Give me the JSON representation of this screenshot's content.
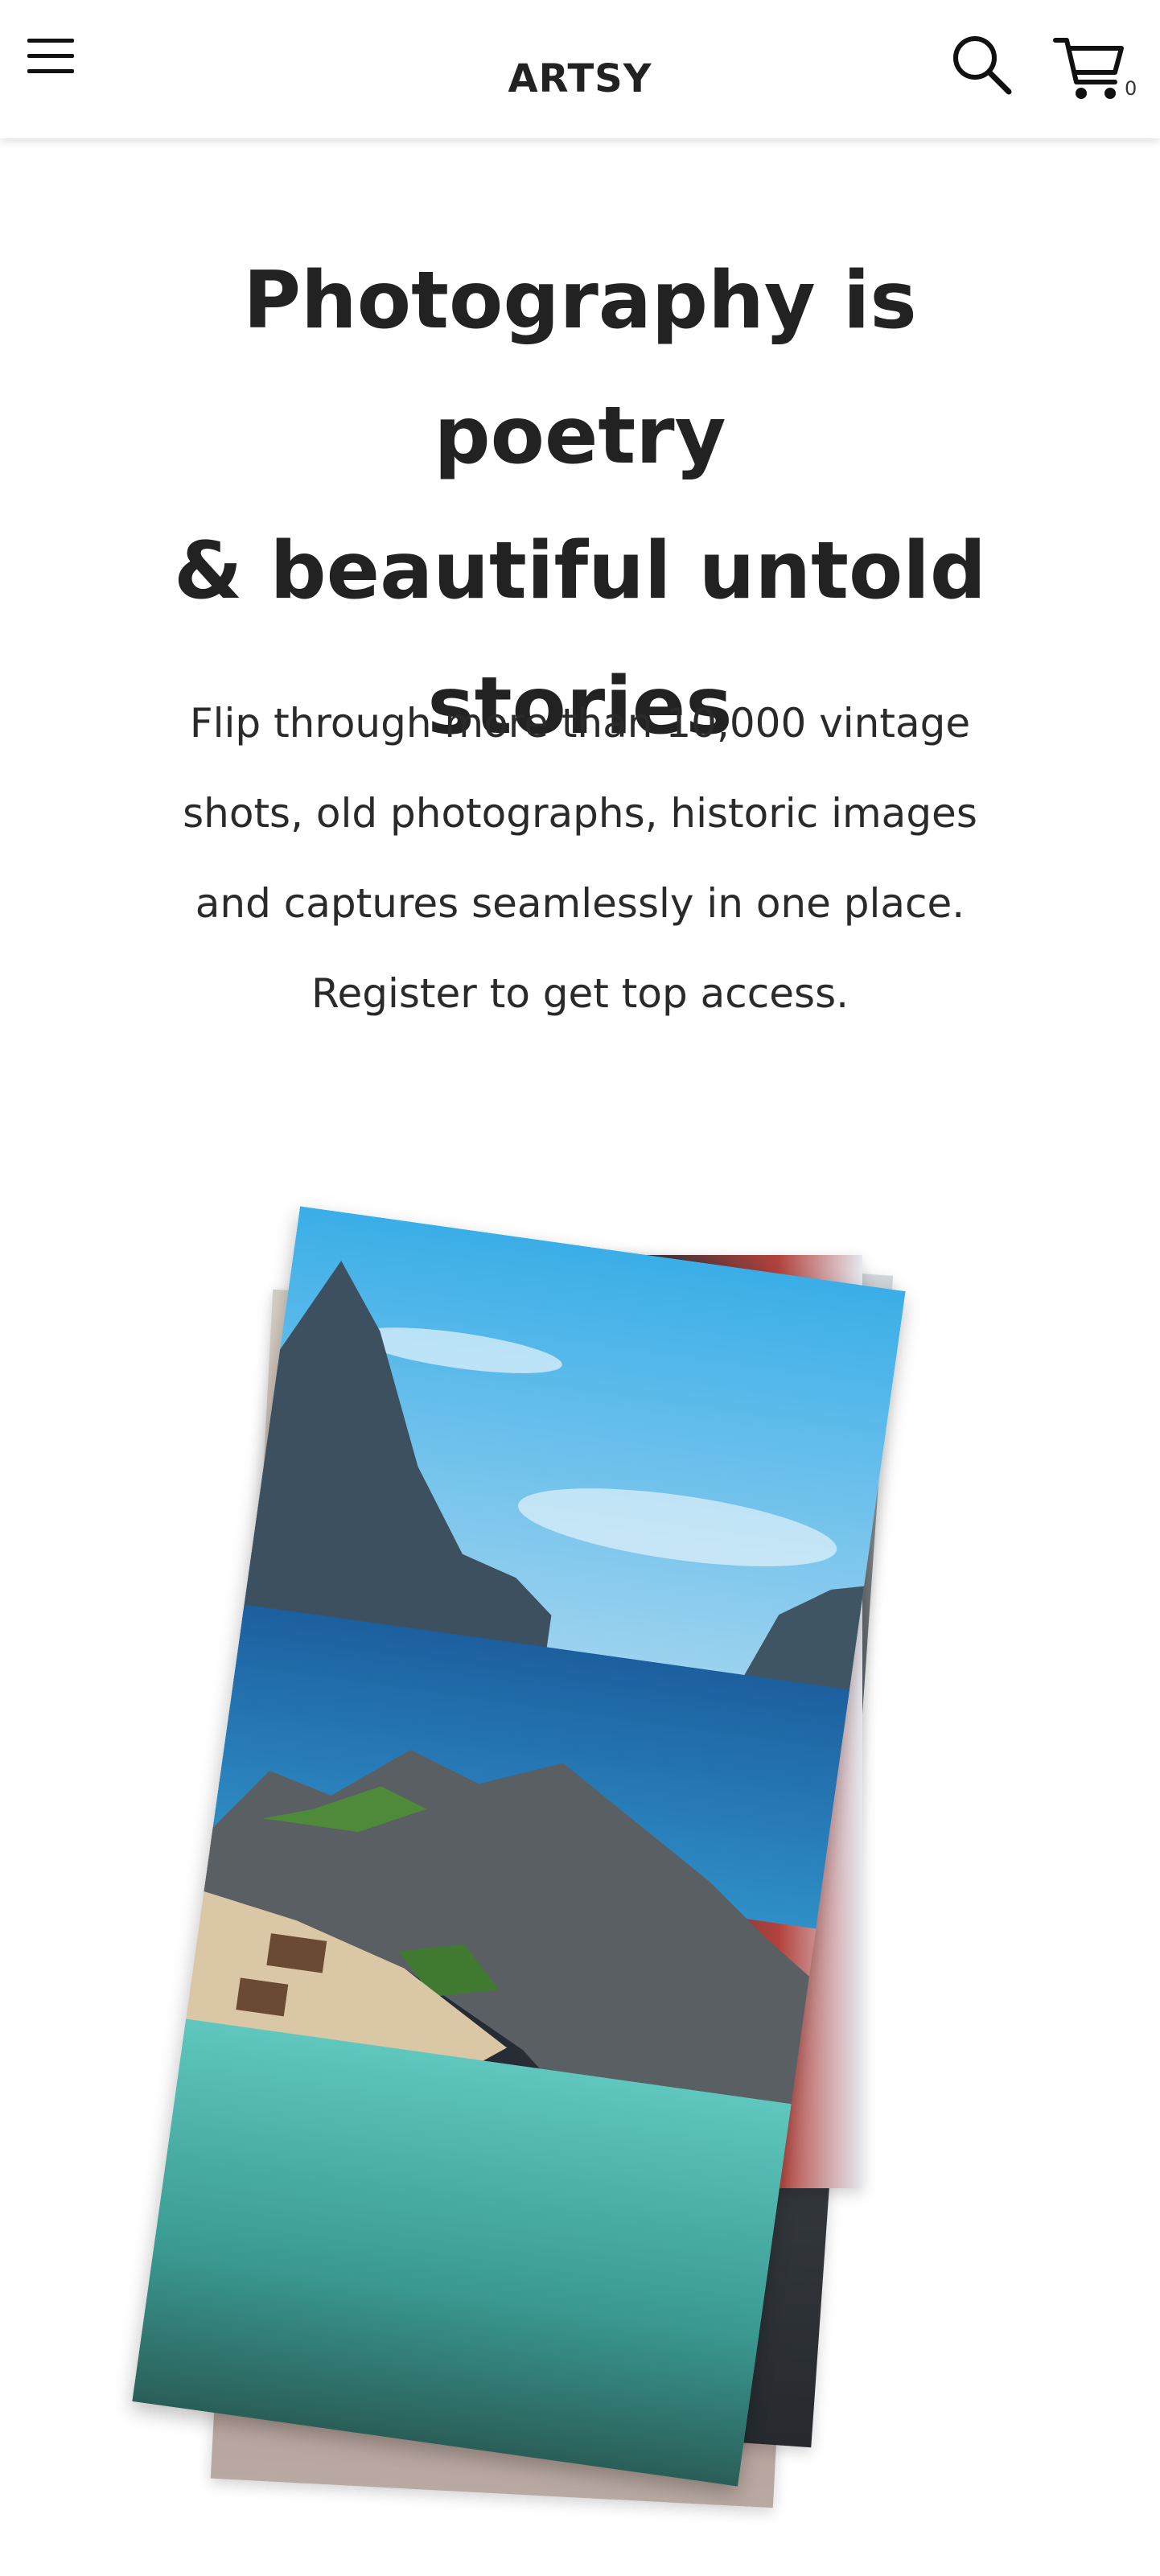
{
  "header": {
    "brand": "ARTSY",
    "menu_icon": "hamburger-menu-icon",
    "search_icon": "search-icon",
    "cart_icon": "shopping-cart-icon",
    "cart_count": "0"
  },
  "hero": {
    "title_lines": [
      "Photography is poetry",
      "& beautiful untold",
      "stories"
    ],
    "subtitle_lines": [
      "Flip through more than 10,000 vintage",
      "shots, old photographs, historic images",
      "and captures seamlessly in one place.",
      "Register to get top access."
    ]
  },
  "gallery": {
    "image_subject": "coastal bay with cliffs, turquoise lagoon and beach huts",
    "stack_count": 4
  },
  "colors": {
    "text": "#222222",
    "background": "#ffffff",
    "sky": "#4fb8ea",
    "sea": "#1f6fb0",
    "lagoon": "#47b9ad",
    "rock": "#5a5f64"
  }
}
